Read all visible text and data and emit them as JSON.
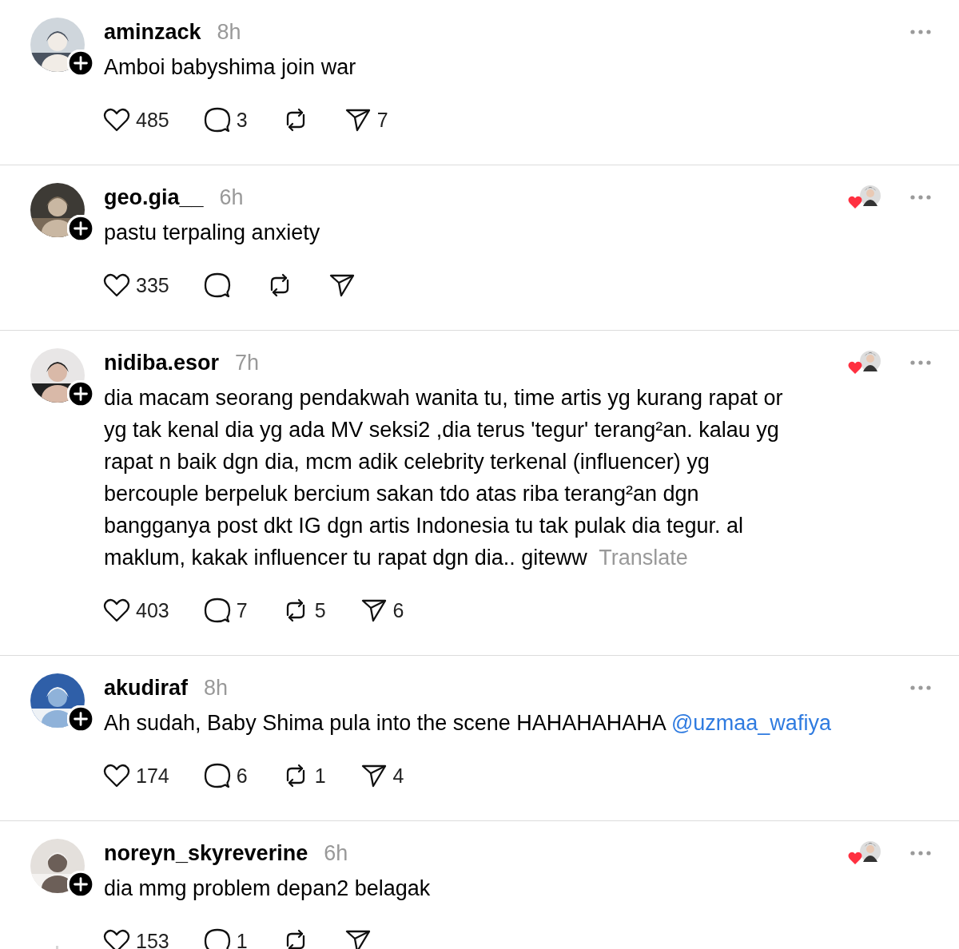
{
  "posts": [
    {
      "username": "aminzack",
      "time": "8h",
      "body": "Amboi babyshima join war",
      "liked_by_author": false,
      "thread_line": false,
      "actions": [
        {
          "kind": "like",
          "count": "485"
        },
        {
          "kind": "reply",
          "count": "3"
        },
        {
          "kind": "repost"
        },
        {
          "kind": "share",
          "count": "7"
        }
      ]
    },
    {
      "username": "geo.gia__",
      "time": "6h",
      "body": "pastu terpaling anxiety",
      "liked_by_author": true,
      "thread_line": false,
      "actions": [
        {
          "kind": "like",
          "count": "335"
        },
        {
          "kind": "reply"
        },
        {
          "kind": "repost"
        },
        {
          "kind": "share"
        }
      ]
    },
    {
      "username": "nidiba.esor",
      "time": "7h",
      "body": "dia macam seorang pendakwah wanita tu, time artis yg kurang rapat or yg tak kenal dia yg ada MV seksi2 ,dia terus 'tegur' terang²an. kalau yg rapat n baik dgn dia, mcm adik celebrity terkenal (influencer) yg bercouple berpeluk bercium sakan tdo atas riba terang²an dgn bangganya post dkt IG dgn artis Indonesia tu tak pulak dia tegur. al maklum, kakak influencer tu rapat dgn dia.. giteww",
      "translate": "Translate",
      "liked_by_author": true,
      "thread_line": false,
      "actions": [
        {
          "kind": "like",
          "count": "403"
        },
        {
          "kind": "reply",
          "count": "7"
        },
        {
          "kind": "repost",
          "count": "5"
        },
        {
          "kind": "share",
          "count": "6"
        }
      ]
    },
    {
      "username": "akudiraf",
      "time": "8h",
      "body": "Ah sudah, Baby Shima pula into the scene HAHAHAHAHA",
      "mention": "@uzmaa_wafiya",
      "liked_by_author": false,
      "thread_line": false,
      "actions": [
        {
          "kind": "like",
          "count": "174"
        },
        {
          "kind": "reply",
          "count": "6"
        },
        {
          "kind": "repost",
          "count": "1"
        },
        {
          "kind": "share",
          "count": "4"
        }
      ]
    },
    {
      "username": "noreyn_skyreverine",
      "time": "6h",
      "body": "dia mmg problem depan2 belagak",
      "liked_by_author": true,
      "thread_line": true,
      "actions": [
        {
          "kind": "like",
          "count": "153"
        },
        {
          "kind": "reply",
          "count": "1"
        },
        {
          "kind": "repost"
        },
        {
          "kind": "share"
        }
      ]
    }
  ]
}
